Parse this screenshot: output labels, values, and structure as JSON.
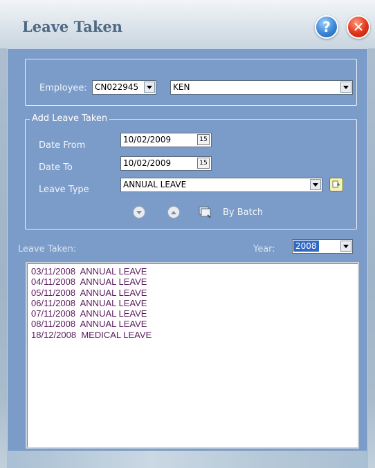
{
  "window": {
    "title": "Leave Taken"
  },
  "title_buttons": {
    "help": "?",
    "close": "✕"
  },
  "employee": {
    "label": "Employee:",
    "code": "CN022945",
    "name": "KEN"
  },
  "add_leave": {
    "legend": "Add Leave Taken",
    "date_from_label": "Date From",
    "date_from": "10/02/2009",
    "date_to_label": "Date To",
    "date_to": "10/02/2009",
    "leave_type_label": "Leave Type",
    "leave_type": "ANNUAL LEAVE",
    "calendar_icon_text": "15",
    "by_batch_label": "By Batch"
  },
  "leave_list": {
    "label": "Leave Taken:",
    "year_label": "Year:",
    "year": "2008",
    "items": [
      {
        "date": "03/11/2008",
        "type": "ANNUAL LEAVE"
      },
      {
        "date": "04/11/2008",
        "type": "ANNUAL LEAVE"
      },
      {
        "date": "05/11/2008",
        "type": "ANNUAL LEAVE"
      },
      {
        "date": "06/11/2008",
        "type": "ANNUAL LEAVE"
      },
      {
        "date": "07/11/2008",
        "type": "ANNUAL LEAVE"
      },
      {
        "date": "08/11/2008",
        "type": "ANNUAL LEAVE"
      },
      {
        "date": "18/12/2008",
        "type": "MEDICAL LEAVE"
      }
    ]
  },
  "colors": {
    "panel": "#7b9cc9",
    "list_text": "#5c1a5e",
    "title_text": "#4f6a85",
    "selection": "#316ac5"
  }
}
